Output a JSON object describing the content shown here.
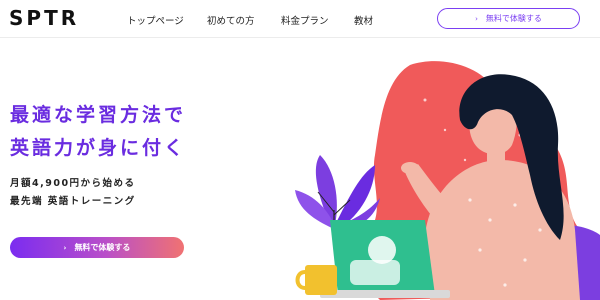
{
  "header": {
    "logo": "SPTR",
    "nav": [
      "トップページ",
      "初めての方",
      "料金プラン",
      "教材"
    ],
    "cta_label": "無料で体験する",
    "cta_arrow": "›"
  },
  "hero": {
    "title_lines": [
      "最適な学習方法で",
      "英語力が身に付く"
    ],
    "sub_lines": [
      "月額4,900円から始める",
      "最先端 英語トレーニング"
    ],
    "cta_label": "無料で体験する",
    "cta_arrow": "›"
  },
  "colors": {
    "brand_purple": "#6a2ce0",
    "accent_coral": "#f05a5a",
    "illustration_skin": "#f3b9a9",
    "illustration_hair": "#0f1a2e"
  },
  "icons": [
    "arrow-right-icon",
    "woman-with-laptop-illustration",
    "plant-icon",
    "mug-icon"
  ]
}
